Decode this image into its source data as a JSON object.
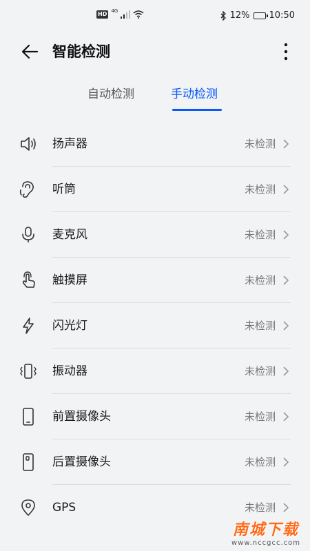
{
  "status_bar": {
    "hd_badge": "HD",
    "network": "4G",
    "battery": "12%",
    "time": "10:50"
  },
  "header": {
    "title": "智能检测"
  },
  "tabs": [
    {
      "label": "自动检测",
      "selected": false
    },
    {
      "label": "手动检测",
      "selected": true
    }
  ],
  "accent_color": "#0a59f7",
  "items": [
    {
      "label": "扬声器",
      "status": "未检测",
      "icon": "speaker-icon"
    },
    {
      "label": "听筒",
      "status": "未检测",
      "icon": "earpiece-icon"
    },
    {
      "label": "麦克风",
      "status": "未检测",
      "icon": "microphone-icon"
    },
    {
      "label": "触摸屏",
      "status": "未检测",
      "icon": "touch-icon"
    },
    {
      "label": "闪光灯",
      "status": "未检测",
      "icon": "flash-icon"
    },
    {
      "label": "振动器",
      "status": "未检测",
      "icon": "vibration-icon"
    },
    {
      "label": "前置摄像头",
      "status": "未检测",
      "icon": "front-camera-icon"
    },
    {
      "label": "后置摄像头",
      "status": "未检测",
      "icon": "rear-camera-icon"
    },
    {
      "label": "GPS",
      "status": "未检测",
      "icon": "location-icon"
    }
  ],
  "watermark": {
    "title": "南城下载",
    "url": "www.nccgcc.com"
  }
}
